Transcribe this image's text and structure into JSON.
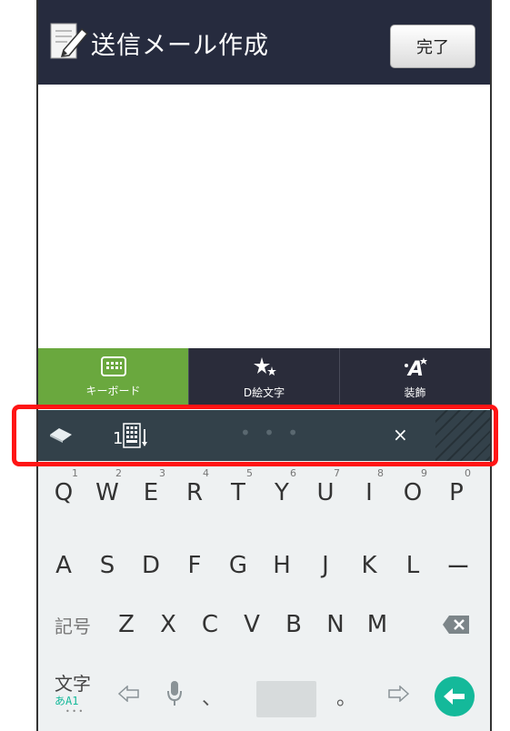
{
  "header": {
    "title": "送信メール作成",
    "done_label": "完了"
  },
  "tabs": [
    {
      "label": "キーボード",
      "icon": "keyboard-icon",
      "active": true
    },
    {
      "label": "D絵文字",
      "icon": "sparkle-emoji-icon",
      "active": false
    },
    {
      "label": "装飾",
      "icon": "decoration-icon",
      "active": false
    }
  ],
  "candidate_bar": {
    "dots": "• • •",
    "close": "×"
  },
  "keyboard": {
    "row1": [
      {
        "key": "Q",
        "hint": "1"
      },
      {
        "key": "W",
        "hint": "2"
      },
      {
        "key": "E",
        "hint": "3"
      },
      {
        "key": "R",
        "hint": "4"
      },
      {
        "key": "T",
        "hint": "5"
      },
      {
        "key": "Y",
        "hint": "6"
      },
      {
        "key": "U",
        "hint": "7"
      },
      {
        "key": "I",
        "hint": "8"
      },
      {
        "key": "O",
        "hint": "9"
      },
      {
        "key": "P",
        "hint": "0"
      }
    ],
    "row2": [
      "A",
      "S",
      "D",
      "F",
      "G",
      "H",
      "J",
      "K",
      "L",
      "ー"
    ],
    "row3": [
      "記号",
      "Z",
      "X",
      "C",
      "V",
      "B",
      "N",
      "M"
    ],
    "row4": {
      "mode_label": "文字",
      "mode_sub": "あA1",
      "comma": "、",
      "period": "。"
    }
  },
  "colors": {
    "header_bg": "#262b3e",
    "active_tab": "#6aa83e",
    "enter": "#14b99a",
    "highlight": "#ff1414"
  }
}
